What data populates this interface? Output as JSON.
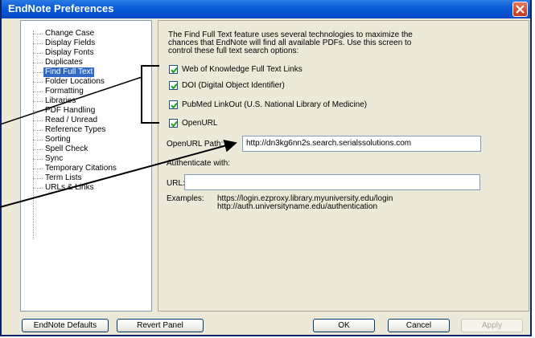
{
  "window": {
    "title": "EndNote Preferences"
  },
  "sidebar": {
    "items": [
      {
        "label": "Change Case"
      },
      {
        "label": "Display Fields"
      },
      {
        "label": "Display Fonts"
      },
      {
        "label": "Duplicates"
      },
      {
        "label": "Find Full Text",
        "selected": true
      },
      {
        "label": "Folder Locations"
      },
      {
        "label": "Formatting"
      },
      {
        "label": "Libraries"
      },
      {
        "label": "PDF Handling"
      },
      {
        "label": "Read / Unread"
      },
      {
        "label": "Reference Types"
      },
      {
        "label": "Sorting"
      },
      {
        "label": "Spell Check"
      },
      {
        "label": "Sync"
      },
      {
        "label": "Temporary Citations"
      },
      {
        "label": "Term Lists"
      },
      {
        "label": "URLs & Links"
      }
    ]
  },
  "panel": {
    "description": [
      "The Find Full Text feature uses several technologies to maximize the",
      "chances that EndNote will find all available PDFs. Use this screen to",
      "control these full text search options:"
    ],
    "options": [
      {
        "label": "Web of Knowledge Full Text Links",
        "checked": true
      },
      {
        "label": "DOI (Digital Object Identifier)",
        "checked": true
      },
      {
        "label": "PubMed LinkOut (U.S. National Library of Medicine)",
        "checked": true
      },
      {
        "label": "OpenURL",
        "checked": true
      }
    ],
    "openurl_path_label": "OpenURL Path:",
    "openurl_path_value": "http://dn3kg6nn2s.search.serialssolutions.com",
    "authenticate_label": "Authenticate with:",
    "url_label": "URL:",
    "url_value": "",
    "examples_label": "Examples:",
    "examples": [
      "https://login.ezproxy.library.myuniversity.edu/login",
      "http://auth.universityname.edu/authentication"
    ]
  },
  "buttons": {
    "endnote_defaults": "EndNote Defaults",
    "revert_panel": "Revert Panel",
    "ok": "OK",
    "cancel": "Cancel",
    "apply": "Apply"
  },
  "colors": {
    "titlebar": "#0a5bd8",
    "selection": "#316ac5",
    "annotation": "#000000",
    "checkmark": "#21a121"
  }
}
